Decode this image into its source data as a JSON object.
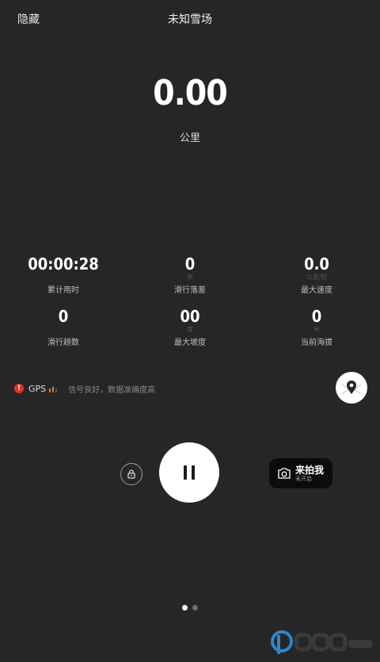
{
  "header": {
    "hide_label": "隐藏",
    "title": "未知雪场"
  },
  "distance": {
    "value": "0.00",
    "unit": "公里"
  },
  "stats": [
    {
      "value": "00:00:28",
      "unit": "",
      "label": "累计用时"
    },
    {
      "value": "0",
      "unit": "米",
      "label": "滑行落差"
    },
    {
      "value": "0.0",
      "unit": "公里/时",
      "label": "最大速度"
    },
    {
      "value": "0",
      "unit": "",
      "label": "滑行趟数"
    },
    {
      "value": "00",
      "unit": "度",
      "label": "最大坡度"
    },
    {
      "value": "0",
      "unit": "米",
      "label": "当前海拔"
    }
  ],
  "gps": {
    "label": "GPS",
    "status": "信号良好，数据准确度高",
    "alert_color": "#e0332c",
    "bar_color": "#e07a1f"
  },
  "controls": {
    "photo_main": "来拍我",
    "photo_sub": "未开启",
    "lock_icon": "lock-icon",
    "pause_icon": "pause-icon",
    "map_icon": "map-pin-icon"
  },
  "pager": {
    "count": 2,
    "active": 0
  },
  "colors": {
    "background": "#262626",
    "accent_white": "#ffffff",
    "button_dark": "#0c0c0c"
  }
}
